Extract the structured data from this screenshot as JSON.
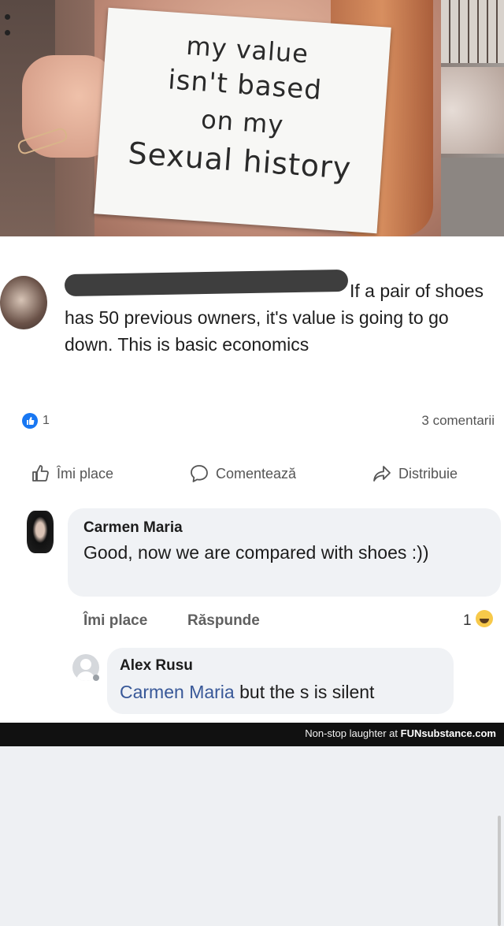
{
  "photo": {
    "sign_lines": [
      "my value",
      "isn't based",
      "on my",
      "Sexual history"
    ]
  },
  "post": {
    "text": "If a pair of shoes has 50 previous owners, it's value is going to go down. This is basic economics",
    "reaction_count": "1",
    "reaction_icon": "like-icon",
    "comments_count": "3 comentarii",
    "actions": {
      "like": "Îmi place",
      "comment": "Comentează",
      "share": "Distribuie"
    }
  },
  "comments": [
    {
      "name": "Carmen Maria",
      "text": "Good, now we are compared with shoes :))",
      "like_label": "Îmi place",
      "reply_label": "Răspunde",
      "reactions": "1"
    },
    {
      "name": "Alex Rusu",
      "mention": "Carmen Maria",
      "text": " but the s is silent"
    }
  ],
  "footer": {
    "prefix": "Non-stop laughter at ",
    "brand": "FUNsubstance.com"
  },
  "colors": {
    "accent": "#1877f2",
    "mention": "#385898"
  }
}
